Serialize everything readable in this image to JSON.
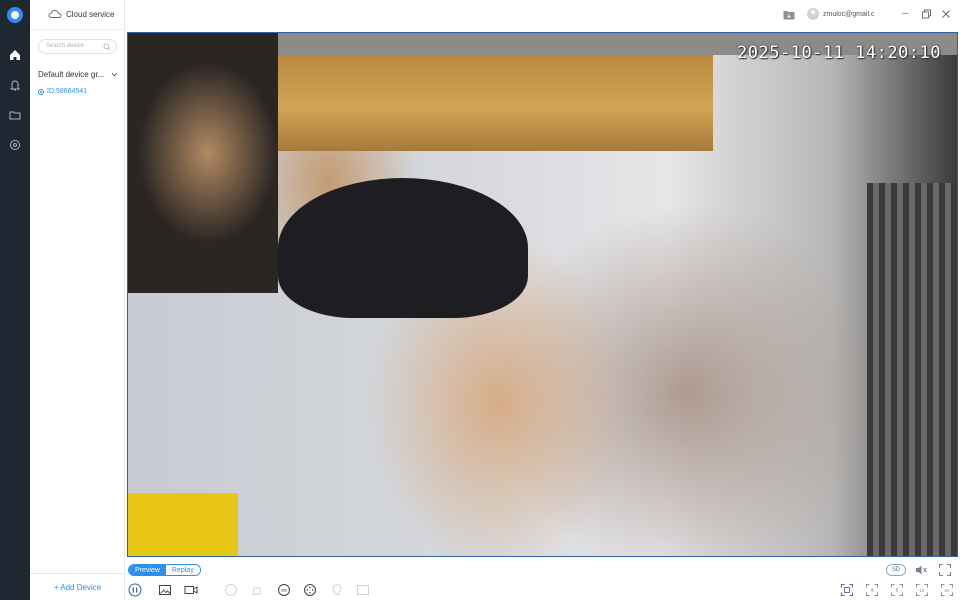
{
  "rail": {
    "items": [
      "home-icon",
      "bell-icon",
      "folder-icon",
      "settings-icon"
    ]
  },
  "sidebar": {
    "cloud_label": "Cloud service",
    "search_placeholder": "Search device",
    "group_label": "Default device gr...",
    "device_label": "ID:58664541",
    "add_device_label": "+ Add Device"
  },
  "topbar": {
    "user_email": "zmuloc@gmail.c"
  },
  "video": {
    "timestamp": "2025-10-11 14:20:10"
  },
  "toolbar": {
    "tabs": [
      {
        "label": "Preview",
        "active": true
      },
      {
        "label": "Replay",
        "active": false
      }
    ],
    "quality_label": "SD"
  },
  "colors": {
    "accent": "#2e8ef0",
    "rail": "#1f2733"
  }
}
